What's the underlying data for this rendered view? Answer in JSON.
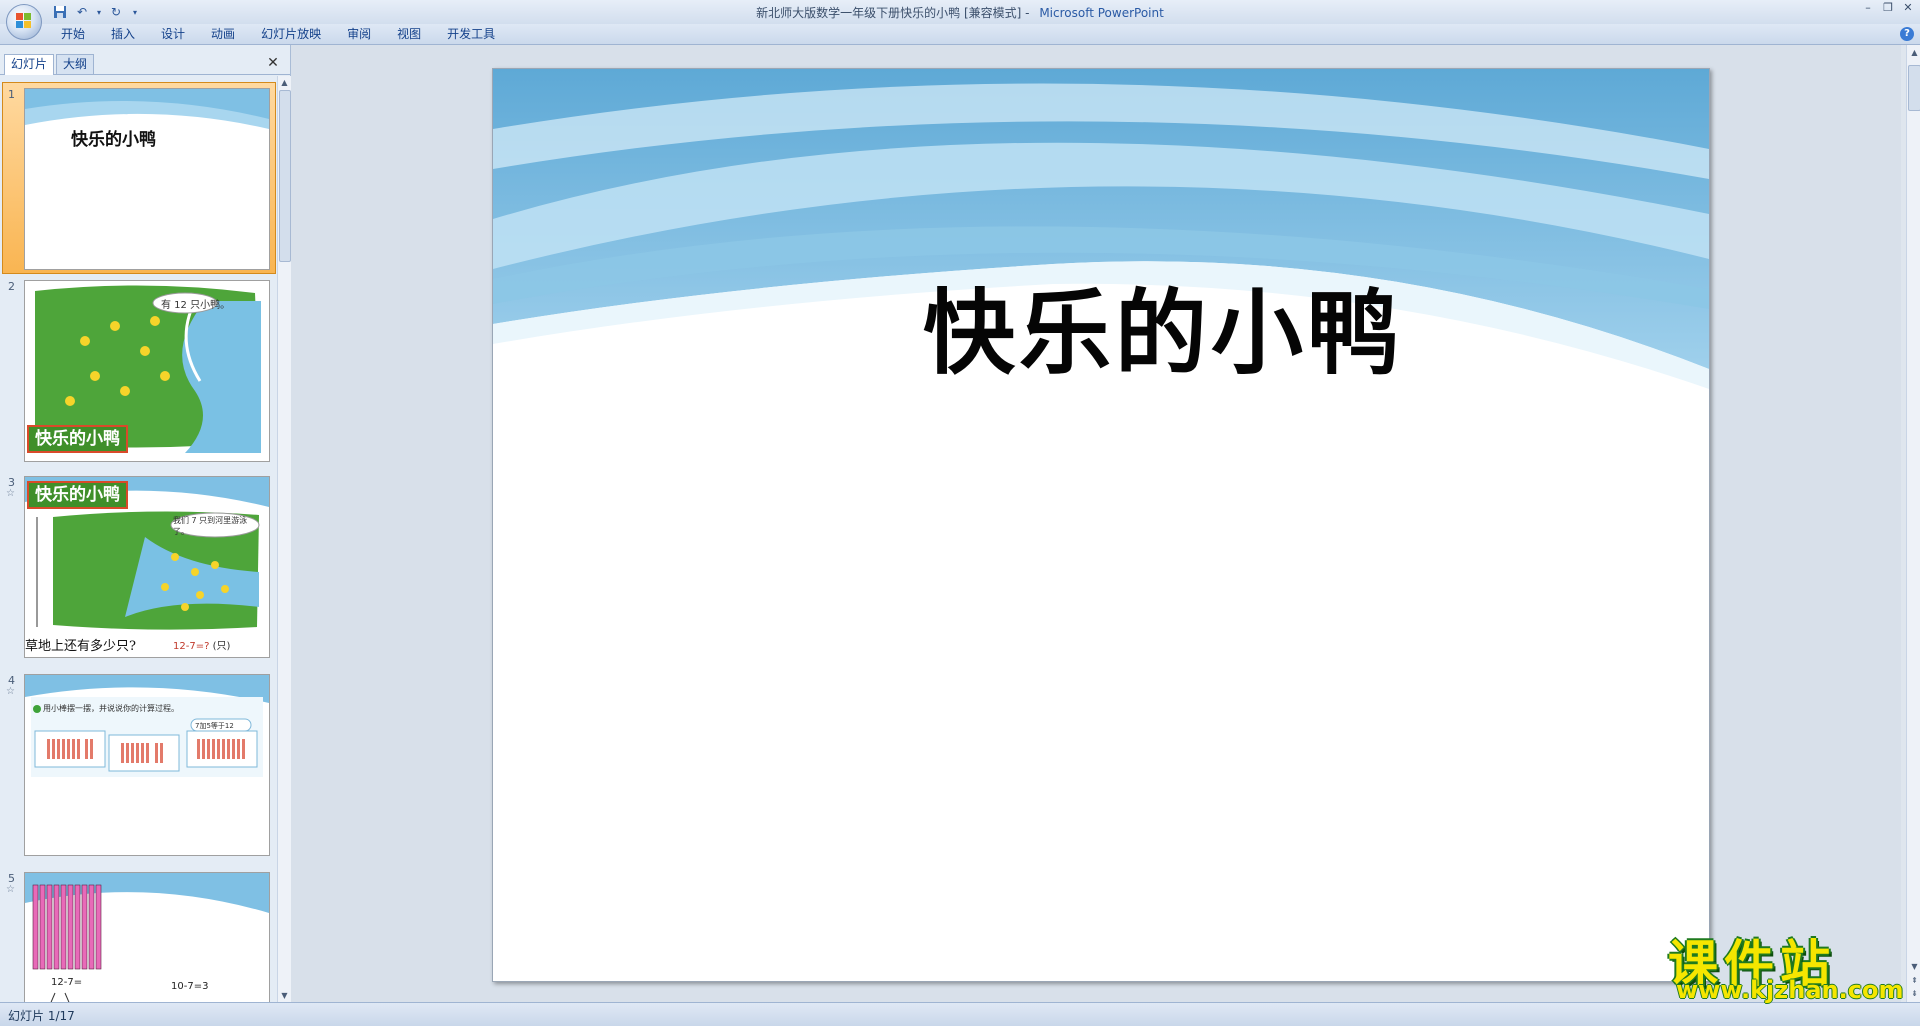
{
  "window": {
    "title": "新北师大版数学一年级下册快乐的小鸭 [兼容模式]",
    "separator": " - ",
    "app_name": "Microsoft PowerPoint"
  },
  "ribbon": {
    "tabs": [
      "开始",
      "插入",
      "设计",
      "动画",
      "幻灯片放映",
      "审阅",
      "视图",
      "开发工具"
    ]
  },
  "left_pane": {
    "tabs": [
      "幻灯片",
      "大纲"
    ]
  },
  "thumbnails": [
    {
      "number": "1",
      "title": "快乐的小鸭"
    },
    {
      "number": "2",
      "label": "快乐的小鸭",
      "bubble": "有 12 只小鸭。"
    },
    {
      "number": "3",
      "label": "快乐的小鸭",
      "bubble": "我们 7 只到河里游泳了。",
      "question": "草地上还有多少只?",
      "eq_a": "12",
      "eq_op": "-",
      "eq_b": "7",
      "eq_eq": "=",
      "eq_c": "?",
      "eq_unit": "(只)"
    },
    {
      "number": "4",
      "text": "用小棒摆一摆，并说说你的计算过程。",
      "bubble": "7加5等于12"
    },
    {
      "number": "5",
      "eq1": "12-7=",
      "eq2": "10-7=3"
    }
  ],
  "slide": {
    "title": "快乐的小鸭"
  },
  "status": {
    "slide_indicator": "幻灯片 1/17"
  },
  "watermark": {
    "line1": "课件站",
    "line2": "www.kjzhan.com"
  },
  "colors": {
    "accent_blue": "#6fb4dc",
    "selection_orange": "#f2a23c",
    "label_green": "#3f8f2a"
  }
}
